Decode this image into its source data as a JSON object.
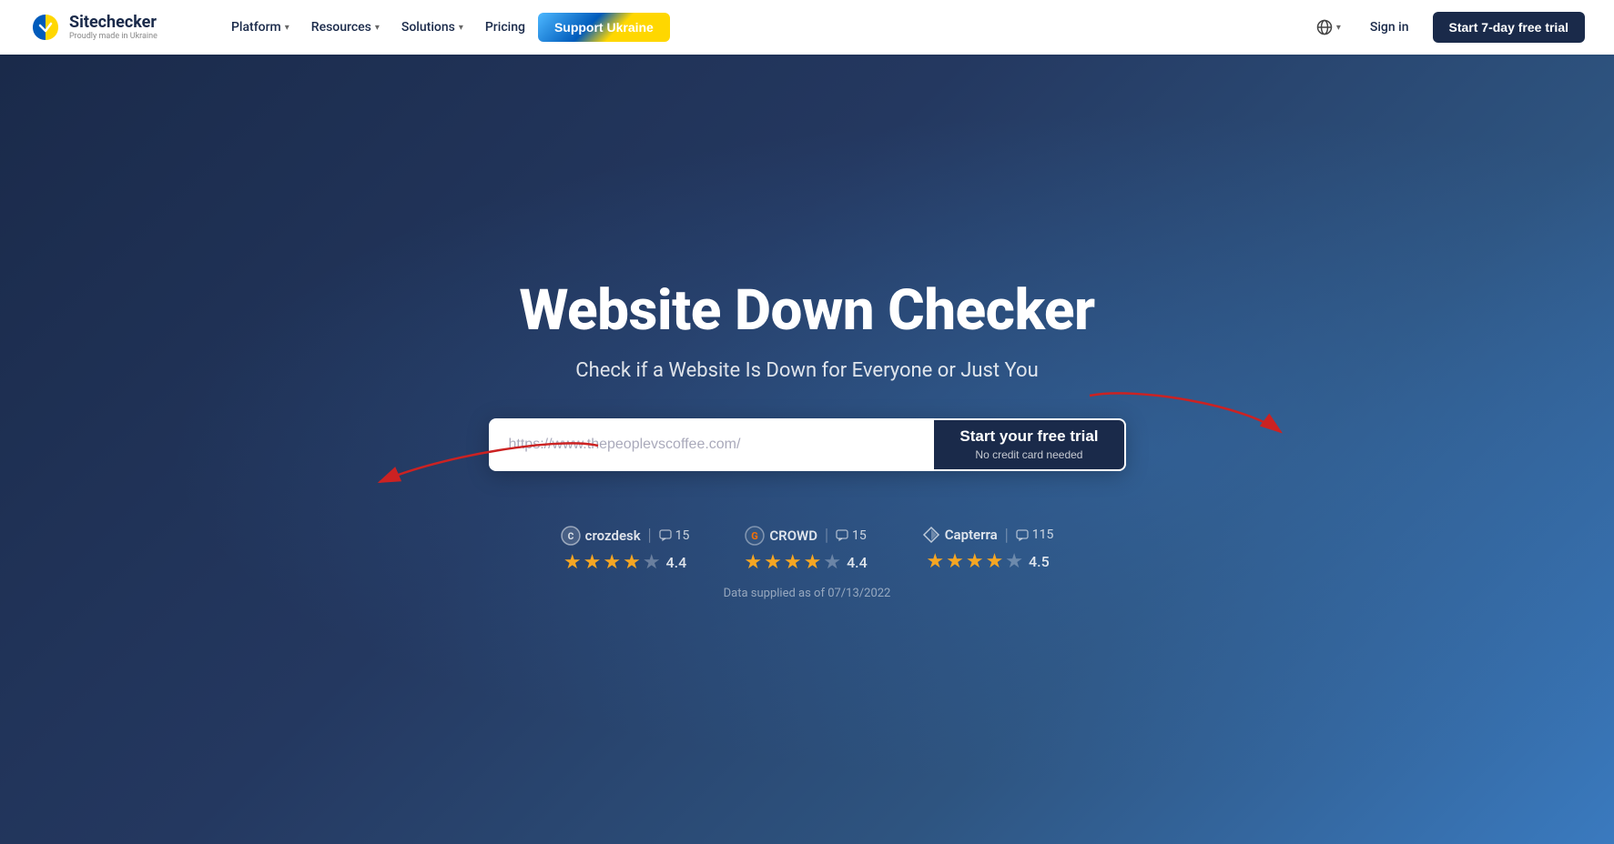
{
  "navbar": {
    "logo_name": "Sitechecker",
    "logo_tagline": "Proudly made in Ukraine",
    "nav_items": [
      {
        "label": "Platform",
        "has_dropdown": true
      },
      {
        "label": "Resources",
        "has_dropdown": true
      },
      {
        "label": "Solutions",
        "has_dropdown": true
      },
      {
        "label": "Pricing",
        "has_dropdown": false
      }
    ],
    "support_ukraine_label": "Support Ukraine",
    "globe_label": "",
    "signin_label": "Sign in",
    "trial_button_label": "Start 7-day free trial"
  },
  "hero": {
    "title": "Website Down Checker",
    "subtitle": "Check if a Website Is Down for Everyone or Just You",
    "input_placeholder": "https://www.thepeoplevscoffee.com/",
    "cta_main": "Start your free trial",
    "cta_sub": "No credit card needed"
  },
  "ratings": [
    {
      "name": "crozdesk",
      "icon": "C",
      "reviews": "15",
      "score": "4.4",
      "stars": [
        1,
        1,
        1,
        1,
        0
      ]
    },
    {
      "name": "CROWD",
      "icon": "G",
      "reviews": "15",
      "score": "4.4",
      "stars": [
        1,
        1,
        1,
        1,
        0
      ]
    },
    {
      "name": "Capterra",
      "icon": "▶",
      "reviews": "115",
      "score": "4.5",
      "stars": [
        1,
        1,
        1,
        1,
        0
      ]
    }
  ],
  "data_supplied": "Data supplied as of 07/13/2022"
}
